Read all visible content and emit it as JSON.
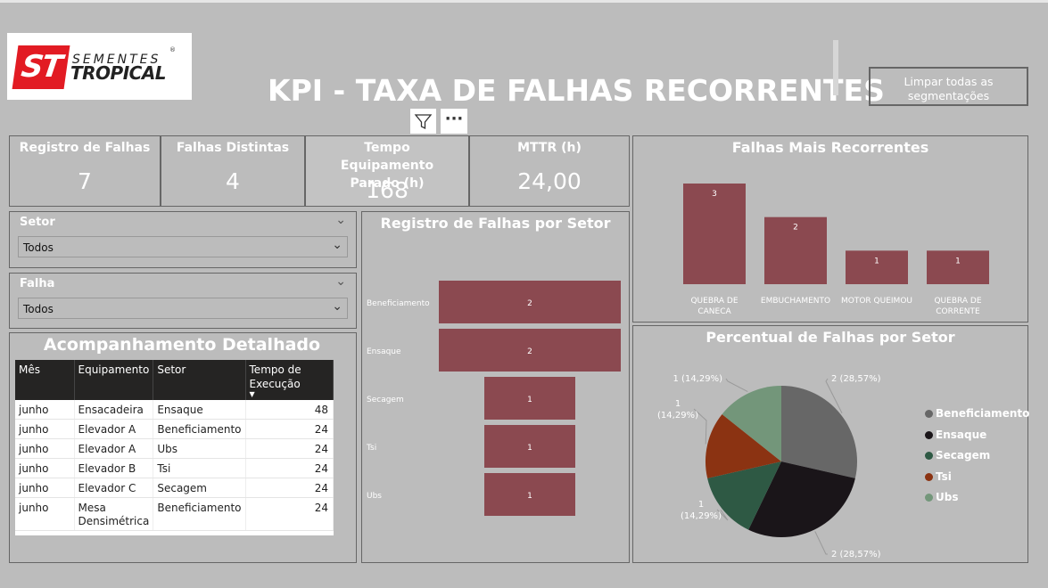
{
  "logo": {
    "mark": "ST",
    "word1": "SEMENTES",
    "word2": "TROPICAL",
    "reg": "®"
  },
  "title": "KPI - TAXA DE FALHAS RECORRENTES",
  "clear_button": "Limpar todas as segmentações",
  "icons": {
    "filter": "filter-icon",
    "more": "more-options-icon",
    "chevron": "chevron-down-icon",
    "sort": "sort-down-icon"
  },
  "more_glyph": "···",
  "kpis": [
    {
      "label": "Registro de Falhas",
      "value": "7"
    },
    {
      "label": "Falhas Distintas",
      "value": "4"
    },
    {
      "label": "Tempo Equipamento Parado (h)",
      "value": "168"
    },
    {
      "label": "MTTR (h)",
      "value": "24,00"
    }
  ],
  "slicers": [
    {
      "label": "Setor",
      "selected": "Todos"
    },
    {
      "label": "Falha",
      "selected": "Todos"
    }
  ],
  "detail": {
    "title": "Acompanhamento Detalhado",
    "columns": [
      "Mês",
      "Equipamento",
      "Setor",
      "Tempo de Execução"
    ],
    "rows": [
      [
        "junho",
        "Ensacadeira",
        "Ensaque",
        "48"
      ],
      [
        "junho",
        "Elevador A",
        "Beneficiamento",
        "24"
      ],
      [
        "junho",
        "Elevador A",
        "Ubs",
        "24"
      ],
      [
        "junho",
        "Elevador B",
        "Tsi",
        "24"
      ],
      [
        "junho",
        "Elevador C",
        "Secagem",
        "24"
      ],
      [
        "junho",
        "Mesa Densimétrica",
        "Beneficiamento",
        "24"
      ]
    ]
  },
  "colors": {
    "bar": "#8b4950",
    "pie": [
      "#676767",
      "#1a1519",
      "#2e5944",
      "#8b3312",
      "#73967a"
    ]
  },
  "chart_data": [
    {
      "type": "bar",
      "orientation": "horizontal",
      "title": "Registro de Falhas por Setor",
      "categories": [
        "Beneficiamento",
        "Ensaque",
        "Secagem",
        "Tsi",
        "Ubs"
      ],
      "values": [
        2,
        2,
        1,
        1,
        1
      ],
      "xlim": [
        0,
        2
      ]
    },
    {
      "type": "bar",
      "title": "Falhas Mais Recorrentes",
      "categories": [
        "QUEBRA DE CANECA",
        "EMBUCHAMENTO",
        "MOTOR QUEIMOU",
        "QUEBRA DE CORRENTE"
      ],
      "values": [
        3,
        2,
        1,
        1
      ],
      "ylim": [
        0,
        3
      ]
    },
    {
      "type": "pie",
      "title": "Percentual de Falhas por Setor",
      "categories": [
        "Beneficiamento",
        "Ensaque",
        "Secagem",
        "Tsi",
        "Ubs"
      ],
      "values": [
        2,
        2,
        1,
        1,
        1
      ],
      "labels": [
        "2 (28,57%)",
        "2 (28,57%)",
        "1 (14,29%)",
        "1 (14,29%)",
        "1 (14,29%)"
      ],
      "legend": "right"
    }
  ]
}
